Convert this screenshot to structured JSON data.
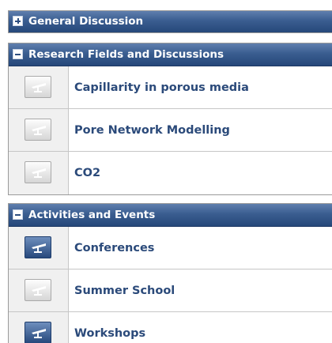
{
  "colors": {
    "header_gradient_top": "#5f7fae",
    "header_gradient_bottom": "#26487a",
    "link_text": "#2b4a7a",
    "icon_cell_bg": "#f0f0f0",
    "active_icon": "#27497c"
  },
  "sections": {
    "general": {
      "title": "General Discussion",
      "state": "collapsed",
      "toggle_icon": "plus-icon"
    },
    "research": {
      "title": "Research Fields and Discussions",
      "state": "expanded",
      "toggle_icon": "minus-icon",
      "items": [
        {
          "label": "Capillarity in porous media",
          "icon": "forum-icon",
          "active": false
        },
        {
          "label": "Pore Network Modelling",
          "icon": "forum-icon",
          "active": false
        },
        {
          "label": "CO2",
          "icon": "forum-icon",
          "active": false
        }
      ]
    },
    "activities": {
      "title": "Activities and Events",
      "state": "expanded",
      "toggle_icon": "minus-icon",
      "items": [
        {
          "label": "Conferences",
          "icon": "forum-icon",
          "active": true
        },
        {
          "label": "Summer School",
          "icon": "forum-icon",
          "active": false
        },
        {
          "label": "Workshops",
          "icon": "forum-icon",
          "active": true
        }
      ]
    }
  }
}
